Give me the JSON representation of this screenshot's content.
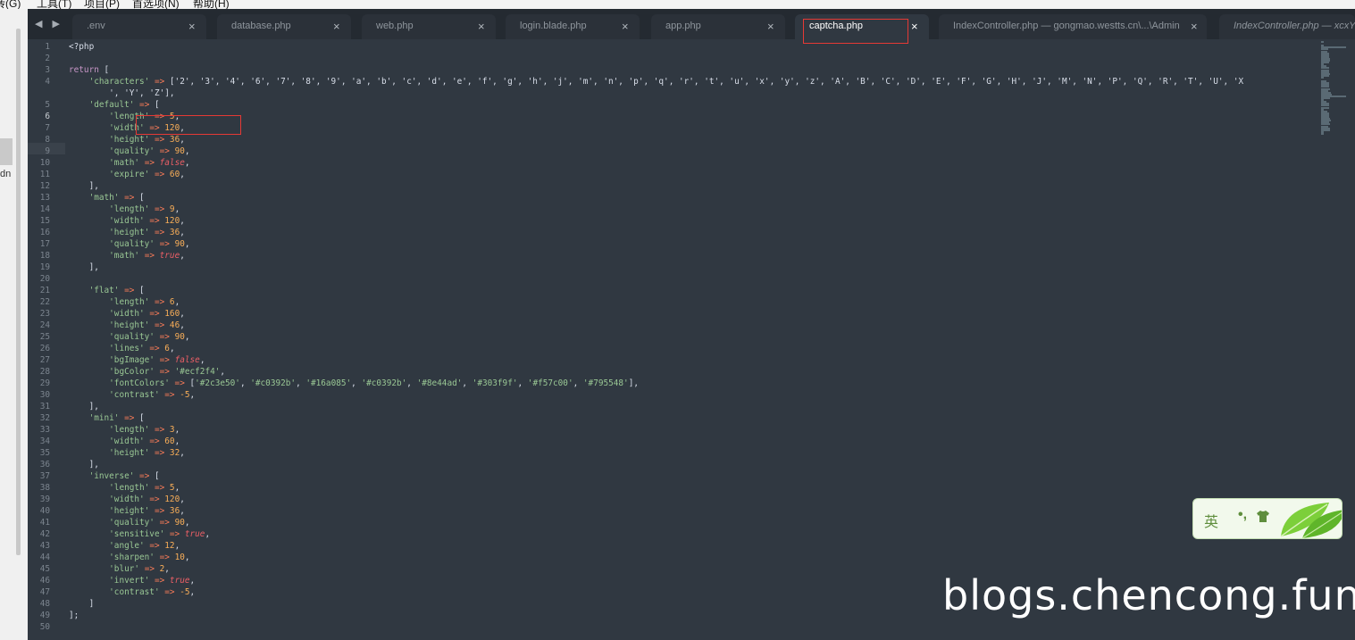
{
  "menu": {
    "items": [
      "转(G)",
      "工具(T)",
      "项目(P)",
      "首选项(N)",
      "帮助(H)"
    ]
  },
  "left_panel": {
    "fragment": "dn"
  },
  "tabs": [
    {
      "label": ".env",
      "active": false
    },
    {
      "label": "database.php",
      "active": false
    },
    {
      "label": "web.php",
      "active": false
    },
    {
      "label": "login.blade.php",
      "active": false
    },
    {
      "label": "app.php",
      "active": false
    },
    {
      "label": "captcha.php",
      "active": true
    },
    {
      "label": "IndexController.php — gongmao.westts.cn\\...\\Admin",
      "active": false
    },
    {
      "label": "IndexController.php — xcxYU",
      "active": false
    }
  ],
  "close_glyph": "×",
  "nav_arrows": "◀ ▶",
  "current_line": 6,
  "code_lines": [
    {
      "n": "1",
      "segs": [
        [
          "<?php",
          "plain"
        ]
      ]
    },
    {
      "n": "2",
      "segs": []
    },
    {
      "n": "3",
      "segs": [
        [
          "return",
          "kw"
        ],
        [
          " [",
          "plain"
        ]
      ]
    },
    {
      "n": "4",
      "segs": [
        [
          "    ",
          "plain"
        ],
        [
          "'characters'",
          "str"
        ],
        [
          " ",
          "plain"
        ],
        [
          "=>",
          "op"
        ],
        [
          " ['2', '3', '4', '6', '7', '8', '9', 'a', 'b', 'c', 'd', 'e', 'f', 'g', 'h', 'j', 'm', 'n', 'p', 'q', 'r', 't', 'u', 'x', 'y', 'z', 'A', 'B', 'C', 'D', 'E', 'F', 'G', 'H', 'J', 'M', 'N', 'P', 'Q', 'R', 'T', 'U', 'X",
          "plain"
        ]
      ]
    },
    {
      "n": "",
      "segs": [
        [
          "        ', 'Y', 'Z'],",
          "plain"
        ]
      ]
    },
    {
      "n": "5",
      "segs": [
        [
          "    ",
          "plain"
        ],
        [
          "'default'",
          "str"
        ],
        [
          " ",
          "plain"
        ],
        [
          "=>",
          "op"
        ],
        [
          " [",
          "plain"
        ]
      ]
    },
    {
      "n": "6",
      "segs": [
        [
          "        ",
          "plain"
        ],
        [
          "'length'",
          "str"
        ],
        [
          " ",
          "plain"
        ],
        [
          "=>",
          "op"
        ],
        [
          " ",
          "plain"
        ],
        [
          "5",
          "num"
        ],
        [
          ",",
          "plain"
        ]
      ]
    },
    {
      "n": "7",
      "segs": [
        [
          "        ",
          "plain"
        ],
        [
          "'width'",
          "str"
        ],
        [
          " ",
          "plain"
        ],
        [
          "=>",
          "op"
        ],
        [
          " ",
          "plain"
        ],
        [
          "120",
          "num"
        ],
        [
          ",",
          "plain"
        ]
      ]
    },
    {
      "n": "8",
      "segs": [
        [
          "        ",
          "plain"
        ],
        [
          "'height'",
          "str"
        ],
        [
          " ",
          "plain"
        ],
        [
          "=>",
          "op"
        ],
        [
          " ",
          "plain"
        ],
        [
          "36",
          "num"
        ],
        [
          ",",
          "plain"
        ]
      ]
    },
    {
      "n": "9",
      "segs": [
        [
          "        ",
          "plain"
        ],
        [
          "'quality'",
          "str"
        ],
        [
          " ",
          "plain"
        ],
        [
          "=>",
          "op"
        ],
        [
          " ",
          "plain"
        ],
        [
          "90",
          "num"
        ],
        [
          ",",
          "plain"
        ]
      ]
    },
    {
      "n": "10",
      "segs": [
        [
          "        ",
          "plain"
        ],
        [
          "'math'",
          "str"
        ],
        [
          " ",
          "plain"
        ],
        [
          "=>",
          "op"
        ],
        [
          " ",
          "plain"
        ],
        [
          "false",
          "bool"
        ],
        [
          ",",
          "plain"
        ]
      ]
    },
    {
      "n": "11",
      "segs": [
        [
          "        ",
          "plain"
        ],
        [
          "'expire'",
          "str"
        ],
        [
          " ",
          "plain"
        ],
        [
          "=>",
          "op"
        ],
        [
          " ",
          "plain"
        ],
        [
          "60",
          "num"
        ],
        [
          ",",
          "plain"
        ]
      ]
    },
    {
      "n": "12",
      "segs": [
        [
          "    ],",
          "plain"
        ]
      ]
    },
    {
      "n": "13",
      "segs": [
        [
          "    ",
          "plain"
        ],
        [
          "'math'",
          "str"
        ],
        [
          " ",
          "plain"
        ],
        [
          "=>",
          "op"
        ],
        [
          " [",
          "plain"
        ]
      ]
    },
    {
      "n": "14",
      "segs": [
        [
          "        ",
          "plain"
        ],
        [
          "'length'",
          "str"
        ],
        [
          " ",
          "plain"
        ],
        [
          "=>",
          "op"
        ],
        [
          " ",
          "plain"
        ],
        [
          "9",
          "num"
        ],
        [
          ",",
          "plain"
        ]
      ]
    },
    {
      "n": "15",
      "segs": [
        [
          "        ",
          "plain"
        ],
        [
          "'width'",
          "str"
        ],
        [
          " ",
          "plain"
        ],
        [
          "=>",
          "op"
        ],
        [
          " ",
          "plain"
        ],
        [
          "120",
          "num"
        ],
        [
          ",",
          "plain"
        ]
      ]
    },
    {
      "n": "16",
      "segs": [
        [
          "        ",
          "plain"
        ],
        [
          "'height'",
          "str"
        ],
        [
          " ",
          "plain"
        ],
        [
          "=>",
          "op"
        ],
        [
          " ",
          "plain"
        ],
        [
          "36",
          "num"
        ],
        [
          ",",
          "plain"
        ]
      ]
    },
    {
      "n": "17",
      "segs": [
        [
          "        ",
          "plain"
        ],
        [
          "'quality'",
          "str"
        ],
        [
          " ",
          "plain"
        ],
        [
          "=>",
          "op"
        ],
        [
          " ",
          "plain"
        ],
        [
          "90",
          "num"
        ],
        [
          ",",
          "plain"
        ]
      ]
    },
    {
      "n": "18",
      "segs": [
        [
          "        ",
          "plain"
        ],
        [
          "'math'",
          "str"
        ],
        [
          " ",
          "plain"
        ],
        [
          "=>",
          "op"
        ],
        [
          " ",
          "plain"
        ],
        [
          "true",
          "bool"
        ],
        [
          ",",
          "plain"
        ]
      ]
    },
    {
      "n": "19",
      "segs": [
        [
          "    ],",
          "plain"
        ]
      ]
    },
    {
      "n": "20",
      "segs": []
    },
    {
      "n": "21",
      "segs": [
        [
          "    ",
          "plain"
        ],
        [
          "'flat'",
          "str"
        ],
        [
          " ",
          "plain"
        ],
        [
          "=>",
          "op"
        ],
        [
          " [",
          "plain"
        ]
      ]
    },
    {
      "n": "22",
      "segs": [
        [
          "        ",
          "plain"
        ],
        [
          "'length'",
          "str"
        ],
        [
          " ",
          "plain"
        ],
        [
          "=>",
          "op"
        ],
        [
          " ",
          "plain"
        ],
        [
          "6",
          "num"
        ],
        [
          ",",
          "plain"
        ]
      ]
    },
    {
      "n": "23",
      "segs": [
        [
          "        ",
          "plain"
        ],
        [
          "'width'",
          "str"
        ],
        [
          " ",
          "plain"
        ],
        [
          "=>",
          "op"
        ],
        [
          " ",
          "plain"
        ],
        [
          "160",
          "num"
        ],
        [
          ",",
          "plain"
        ]
      ]
    },
    {
      "n": "24",
      "segs": [
        [
          "        ",
          "plain"
        ],
        [
          "'height'",
          "str"
        ],
        [
          " ",
          "plain"
        ],
        [
          "=>",
          "op"
        ],
        [
          " ",
          "plain"
        ],
        [
          "46",
          "num"
        ],
        [
          ",",
          "plain"
        ]
      ]
    },
    {
      "n": "25",
      "segs": [
        [
          "        ",
          "plain"
        ],
        [
          "'quality'",
          "str"
        ],
        [
          " ",
          "plain"
        ],
        [
          "=>",
          "op"
        ],
        [
          " ",
          "plain"
        ],
        [
          "90",
          "num"
        ],
        [
          ",",
          "plain"
        ]
      ]
    },
    {
      "n": "26",
      "segs": [
        [
          "        ",
          "plain"
        ],
        [
          "'lines'",
          "str"
        ],
        [
          " ",
          "plain"
        ],
        [
          "=>",
          "op"
        ],
        [
          " ",
          "plain"
        ],
        [
          "6",
          "num"
        ],
        [
          ",",
          "plain"
        ]
      ]
    },
    {
      "n": "27",
      "segs": [
        [
          "        ",
          "plain"
        ],
        [
          "'bgImage'",
          "str"
        ],
        [
          " ",
          "plain"
        ],
        [
          "=>",
          "op"
        ],
        [
          " ",
          "plain"
        ],
        [
          "false",
          "bool"
        ],
        [
          ",",
          "plain"
        ]
      ]
    },
    {
      "n": "28",
      "segs": [
        [
          "        ",
          "plain"
        ],
        [
          "'bgColor'",
          "str"
        ],
        [
          " ",
          "plain"
        ],
        [
          "=>",
          "op"
        ],
        [
          " ",
          "plain"
        ],
        [
          "'#ecf2f4'",
          "str"
        ],
        [
          ",",
          "plain"
        ]
      ]
    },
    {
      "n": "29",
      "segs": [
        [
          "        ",
          "plain"
        ],
        [
          "'fontColors'",
          "str"
        ],
        [
          " ",
          "plain"
        ],
        [
          "=>",
          "op"
        ],
        [
          " [",
          "plain"
        ],
        [
          "'#2c3e50'",
          "str"
        ],
        [
          ", ",
          "plain"
        ],
        [
          "'#c0392b'",
          "str"
        ],
        [
          ", ",
          "plain"
        ],
        [
          "'#16a085'",
          "str"
        ],
        [
          ", ",
          "plain"
        ],
        [
          "'#c0392b'",
          "str"
        ],
        [
          ", ",
          "plain"
        ],
        [
          "'#8e44ad'",
          "str"
        ],
        [
          ", ",
          "plain"
        ],
        [
          "'#303f9f'",
          "str"
        ],
        [
          ", ",
          "plain"
        ],
        [
          "'#f57c00'",
          "str"
        ],
        [
          ", ",
          "plain"
        ],
        [
          "'#795548'",
          "str"
        ],
        [
          "],",
          "plain"
        ]
      ]
    },
    {
      "n": "30",
      "segs": [
        [
          "        ",
          "plain"
        ],
        [
          "'contrast'",
          "str"
        ],
        [
          " ",
          "plain"
        ],
        [
          "=>",
          "op"
        ],
        [
          " ",
          "plain"
        ],
        [
          "-5",
          "num"
        ],
        [
          ",",
          "plain"
        ]
      ]
    },
    {
      "n": "31",
      "segs": [
        [
          "    ],",
          "plain"
        ]
      ]
    },
    {
      "n": "32",
      "segs": [
        [
          "    ",
          "plain"
        ],
        [
          "'mini'",
          "str"
        ],
        [
          " ",
          "plain"
        ],
        [
          "=>",
          "op"
        ],
        [
          " [",
          "plain"
        ]
      ]
    },
    {
      "n": "33",
      "segs": [
        [
          "        ",
          "plain"
        ],
        [
          "'length'",
          "str"
        ],
        [
          " ",
          "plain"
        ],
        [
          "=>",
          "op"
        ],
        [
          " ",
          "plain"
        ],
        [
          "3",
          "num"
        ],
        [
          ",",
          "plain"
        ]
      ]
    },
    {
      "n": "34",
      "segs": [
        [
          "        ",
          "plain"
        ],
        [
          "'width'",
          "str"
        ],
        [
          " ",
          "plain"
        ],
        [
          "=>",
          "op"
        ],
        [
          " ",
          "plain"
        ],
        [
          "60",
          "num"
        ],
        [
          ",",
          "plain"
        ]
      ]
    },
    {
      "n": "35",
      "segs": [
        [
          "        ",
          "plain"
        ],
        [
          "'height'",
          "str"
        ],
        [
          " ",
          "plain"
        ],
        [
          "=>",
          "op"
        ],
        [
          " ",
          "plain"
        ],
        [
          "32",
          "num"
        ],
        [
          ",",
          "plain"
        ]
      ]
    },
    {
      "n": "36",
      "segs": [
        [
          "    ],",
          "plain"
        ]
      ]
    },
    {
      "n": "37",
      "segs": [
        [
          "    ",
          "plain"
        ],
        [
          "'inverse'",
          "str"
        ],
        [
          " ",
          "plain"
        ],
        [
          "=>",
          "op"
        ],
        [
          " [",
          "plain"
        ]
      ]
    },
    {
      "n": "38",
      "segs": [
        [
          "        ",
          "plain"
        ],
        [
          "'length'",
          "str"
        ],
        [
          " ",
          "plain"
        ],
        [
          "=>",
          "op"
        ],
        [
          " ",
          "plain"
        ],
        [
          "5",
          "num"
        ],
        [
          ",",
          "plain"
        ]
      ]
    },
    {
      "n": "39",
      "segs": [
        [
          "        ",
          "plain"
        ],
        [
          "'width'",
          "str"
        ],
        [
          " ",
          "plain"
        ],
        [
          "=>",
          "op"
        ],
        [
          " ",
          "plain"
        ],
        [
          "120",
          "num"
        ],
        [
          ",",
          "plain"
        ]
      ]
    },
    {
      "n": "40",
      "segs": [
        [
          "        ",
          "plain"
        ],
        [
          "'height'",
          "str"
        ],
        [
          " ",
          "plain"
        ],
        [
          "=>",
          "op"
        ],
        [
          " ",
          "plain"
        ],
        [
          "36",
          "num"
        ],
        [
          ",",
          "plain"
        ]
      ]
    },
    {
      "n": "41",
      "segs": [
        [
          "        ",
          "plain"
        ],
        [
          "'quality'",
          "str"
        ],
        [
          " ",
          "plain"
        ],
        [
          "=>",
          "op"
        ],
        [
          " ",
          "plain"
        ],
        [
          "90",
          "num"
        ],
        [
          ",",
          "plain"
        ]
      ]
    },
    {
      "n": "42",
      "segs": [
        [
          "        ",
          "plain"
        ],
        [
          "'sensitive'",
          "str"
        ],
        [
          " ",
          "plain"
        ],
        [
          "=>",
          "op"
        ],
        [
          " ",
          "plain"
        ],
        [
          "true",
          "bool"
        ],
        [
          ",",
          "plain"
        ]
      ]
    },
    {
      "n": "43",
      "segs": [
        [
          "        ",
          "plain"
        ],
        [
          "'angle'",
          "str"
        ],
        [
          " ",
          "plain"
        ],
        [
          "=>",
          "op"
        ],
        [
          " ",
          "plain"
        ],
        [
          "12",
          "num"
        ],
        [
          ",",
          "plain"
        ]
      ]
    },
    {
      "n": "44",
      "segs": [
        [
          "        ",
          "plain"
        ],
        [
          "'sharpen'",
          "str"
        ],
        [
          " ",
          "plain"
        ],
        [
          "=>",
          "op"
        ],
        [
          " ",
          "plain"
        ],
        [
          "10",
          "num"
        ],
        [
          ",",
          "plain"
        ]
      ]
    },
    {
      "n": "45",
      "segs": [
        [
          "        ",
          "plain"
        ],
        [
          "'blur'",
          "str"
        ],
        [
          " ",
          "plain"
        ],
        [
          "=>",
          "op"
        ],
        [
          " ",
          "plain"
        ],
        [
          "2",
          "num"
        ],
        [
          ",",
          "plain"
        ]
      ]
    },
    {
      "n": "46",
      "segs": [
        [
          "        ",
          "plain"
        ],
        [
          "'invert'",
          "str"
        ],
        [
          " ",
          "plain"
        ],
        [
          "=>",
          "op"
        ],
        [
          " ",
          "plain"
        ],
        [
          "true",
          "bool"
        ],
        [
          ",",
          "plain"
        ]
      ]
    },
    {
      "n": "47",
      "segs": [
        [
          "        ",
          "plain"
        ],
        [
          "'contrast'",
          "str"
        ],
        [
          " ",
          "plain"
        ],
        [
          "=>",
          "op"
        ],
        [
          " ",
          "plain"
        ],
        [
          "-5",
          "num"
        ],
        [
          ",",
          "plain"
        ]
      ]
    },
    {
      "n": "48",
      "segs": [
        [
          "    ]",
          "plain"
        ]
      ]
    },
    {
      "n": "49",
      "segs": [
        [
          "];",
          "plain"
        ]
      ]
    },
    {
      "n": "50",
      "segs": []
    }
  ],
  "syntax_colors": {
    "plain": "#d8dee9",
    "kw": "#c695c6",
    "str": "#99c794",
    "num": "#f9ae58",
    "op": "#f97b58",
    "bool": "#ec5f66"
  },
  "ime": {
    "lang_char": "英",
    "punct": "•,",
    "icon": "shirt-icon"
  },
  "watermark": "blogs.chencong.fun"
}
